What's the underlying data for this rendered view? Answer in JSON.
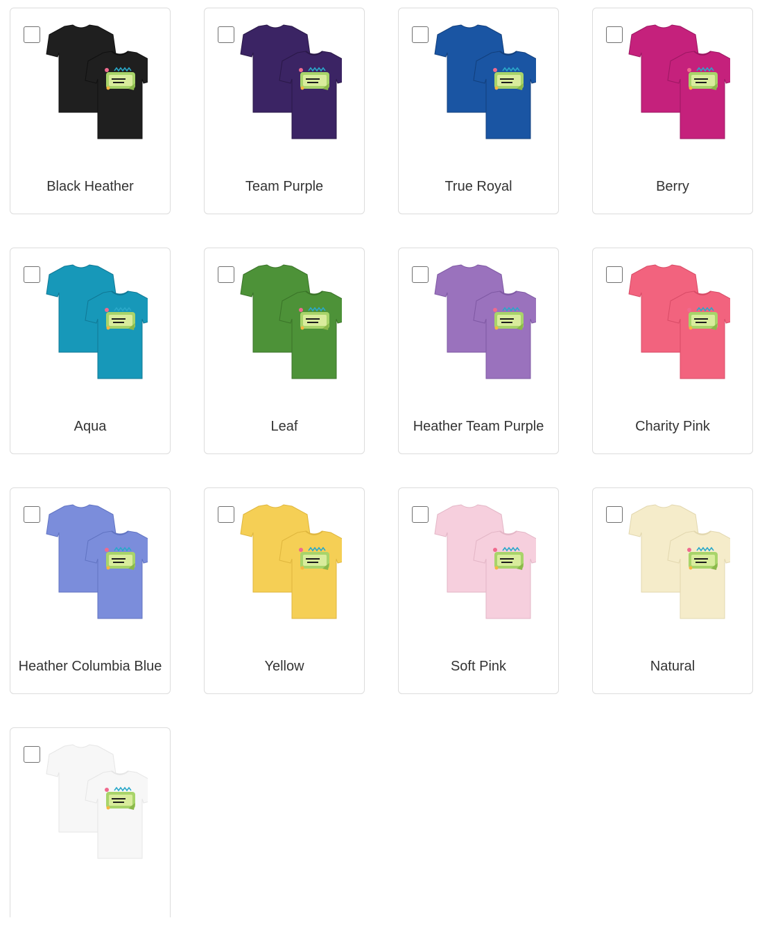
{
  "colors": [
    {
      "label": "Black Heather",
      "fill": "#1f1f1f",
      "shade": "#101010"
    },
    {
      "label": "Team Purple",
      "fill": "#3b2464",
      "shade": "#2a1848"
    },
    {
      "label": "True Royal",
      "fill": "#1a55a3",
      "shade": "#123f7c"
    },
    {
      "label": "Berry",
      "fill": "#c5217c",
      "shade": "#9c1762"
    },
    {
      "label": "Aqua",
      "fill": "#1798b9",
      "shade": "#107895"
    },
    {
      "label": "Leaf",
      "fill": "#4d9238",
      "shade": "#3a7328"
    },
    {
      "label": "Heather Team Purple",
      "fill": "#9a72bd",
      "shade": "#7e58a3"
    },
    {
      "label": "Charity Pink",
      "fill": "#f2637e",
      "shade": "#d84b66"
    },
    {
      "label": "Heather Columbia Blue",
      "fill": "#7b8ddb",
      "shade": "#6073c2"
    },
    {
      "label": "Yellow",
      "fill": "#f5cf55",
      "shade": "#dfb63d"
    },
    {
      "label": "Soft Pink",
      "fill": "#f6cfdd",
      "shade": "#e3b6c6"
    },
    {
      "label": "Natural",
      "fill": "#f5ecca",
      "shade": "#e2d7af"
    },
    {
      "label": "",
      "fill": "#f7f7f7",
      "shade": "#e6e6e6"
    }
  ]
}
